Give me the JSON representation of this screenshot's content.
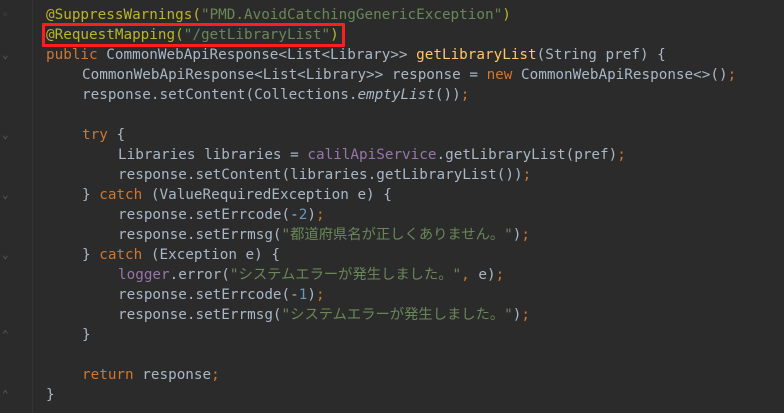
{
  "editor": {
    "lines": [
      {
        "indent": 1,
        "tokens": [
          {
            "t": "@SuppressWarnings(",
            "c": "a"
          },
          {
            "t": "\"PMD.AvoidCatchingGenericException\"",
            "c": "s"
          },
          {
            "t": ")",
            "c": "a"
          }
        ]
      },
      {
        "indent": 1,
        "tokens": [
          {
            "t": "@RequestMapping(",
            "c": "a"
          },
          {
            "t": "\"/getLibraryList\"",
            "c": "s"
          },
          {
            "t": ")",
            "c": "a"
          }
        ]
      },
      {
        "indent": 1,
        "tokens": [
          {
            "t": "public ",
            "c": "k"
          },
          {
            "t": "CommonWebApiResponse<List<Library>> ",
            "c": "plain"
          },
          {
            "t": "getLibraryList",
            "c": "m"
          },
          {
            "t": "(String pref) {",
            "c": "plain"
          }
        ]
      },
      {
        "indent": 2,
        "tokens": [
          {
            "t": "CommonWebApiResponse<List<Library>> response = ",
            "c": "plain"
          },
          {
            "t": "new ",
            "c": "k"
          },
          {
            "t": "CommonWebApiResponse<>()",
            "c": "plain"
          },
          {
            "t": ";",
            "c": "k"
          }
        ]
      },
      {
        "indent": 2,
        "tokens": [
          {
            "t": "response.setContent(Collections.",
            "c": "plain"
          },
          {
            "t": "emptyList",
            "c": "i"
          },
          {
            "t": "())",
            "c": "plain"
          },
          {
            "t": ";",
            "c": "k"
          }
        ]
      },
      {
        "indent": 0,
        "tokens": []
      },
      {
        "indent": 2,
        "tokens": [
          {
            "t": "try ",
            "c": "k"
          },
          {
            "t": "{",
            "c": "plain"
          }
        ]
      },
      {
        "indent": 3,
        "tokens": [
          {
            "t": "Libraries libraries = ",
            "c": "plain"
          },
          {
            "t": "calilApiService",
            "c": "f"
          },
          {
            "t": ".getLibraryList(pref)",
            "c": "plain"
          },
          {
            "t": ";",
            "c": "k"
          }
        ]
      },
      {
        "indent": 3,
        "tokens": [
          {
            "t": "response.setContent(libraries.getLibraryList())",
            "c": "plain"
          },
          {
            "t": ";",
            "c": "k"
          }
        ]
      },
      {
        "indent": 2,
        "tokens": [
          {
            "t": "} ",
            "c": "plain"
          },
          {
            "t": "catch ",
            "c": "k"
          },
          {
            "t": "(ValueRequiredException e) {",
            "c": "plain"
          }
        ]
      },
      {
        "indent": 3,
        "tokens": [
          {
            "t": "response.setErrcode(-",
            "c": "plain"
          },
          {
            "t": "2",
            "c": "n"
          },
          {
            "t": ")",
            "c": "plain"
          },
          {
            "t": ";",
            "c": "k"
          }
        ]
      },
      {
        "indent": 3,
        "tokens": [
          {
            "t": "response.setErrmsg(",
            "c": "plain"
          },
          {
            "t": "\"都道府県名が正しくありません。\"",
            "c": "s"
          },
          {
            "t": ")",
            "c": "plain"
          },
          {
            "t": ";",
            "c": "k"
          }
        ]
      },
      {
        "indent": 2,
        "tokens": [
          {
            "t": "} ",
            "c": "plain"
          },
          {
            "t": "catch ",
            "c": "k"
          },
          {
            "t": "(Exception e) {",
            "c": "plain"
          }
        ]
      },
      {
        "indent": 3,
        "tokens": [
          {
            "t": "logger",
            "c": "f"
          },
          {
            "t": ".error(",
            "c": "plain"
          },
          {
            "t": "\"システムエラーが発生しました。\"",
            "c": "s"
          },
          {
            "t": ", ",
            "c": "k"
          },
          {
            "t": "e)",
            "c": "plain"
          },
          {
            "t": ";",
            "c": "k"
          }
        ]
      },
      {
        "indent": 3,
        "tokens": [
          {
            "t": "response.setErrcode(-",
            "c": "plain"
          },
          {
            "t": "1",
            "c": "n"
          },
          {
            "t": ")",
            "c": "plain"
          },
          {
            "t": ";",
            "c": "k"
          }
        ]
      },
      {
        "indent": 3,
        "tokens": [
          {
            "t": "response.setErrmsg(",
            "c": "plain"
          },
          {
            "t": "\"システムエラーが発生しました。\"",
            "c": "s"
          },
          {
            "t": ")",
            "c": "plain"
          },
          {
            "t": ";",
            "c": "k"
          }
        ]
      },
      {
        "indent": 2,
        "tokens": [
          {
            "t": "}",
            "c": "plain"
          }
        ]
      },
      {
        "indent": 0,
        "tokens": []
      },
      {
        "indent": 2,
        "tokens": [
          {
            "t": "return ",
            "c": "k"
          },
          {
            "t": "response",
            "c": "plain"
          },
          {
            "t": ";",
            "c": "k"
          }
        ]
      },
      {
        "indent": 1,
        "tokens": [
          {
            "t": "}",
            "c": "plain"
          }
        ]
      }
    ],
    "highlighted_line": 1
  },
  "colors": {
    "background": "#2b2b2b",
    "highlight_box": "#ff1d1d",
    "keyword": "#cc7832",
    "string": "#6a8759",
    "annotation": "#bbb529",
    "field": "#9876aa",
    "method": "#ffc66d",
    "number": "#6897bb",
    "default": "#a9b7c6"
  }
}
